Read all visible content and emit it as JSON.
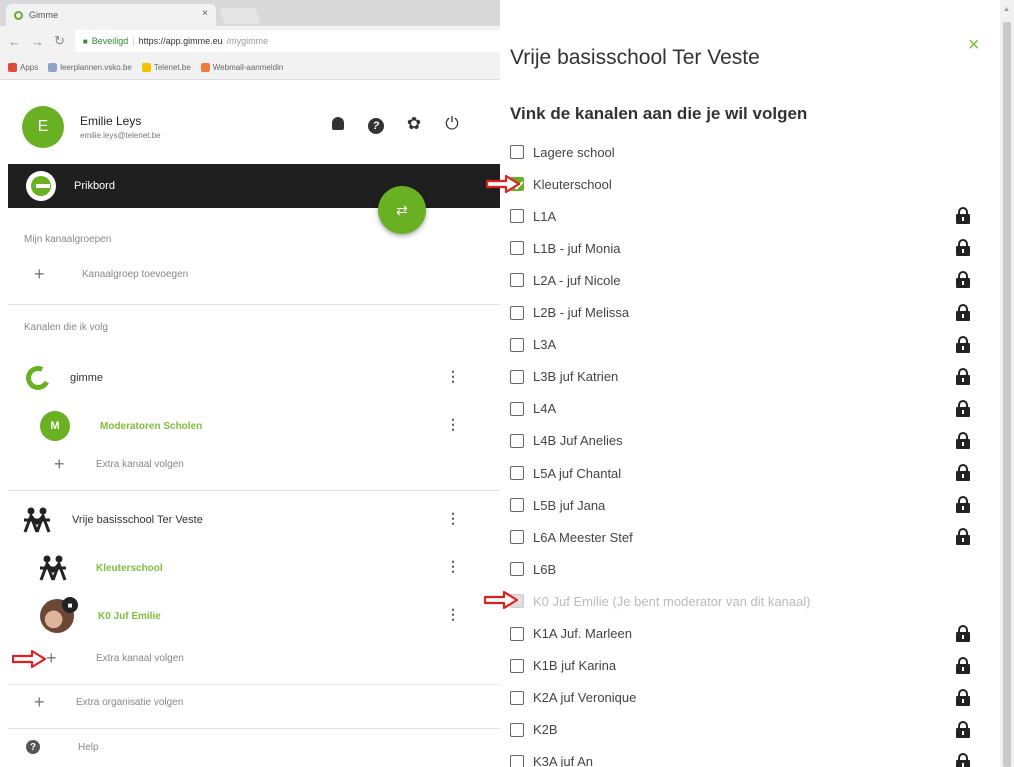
{
  "browser": {
    "tab_title": "Gimme",
    "tab_close": "×",
    "secure_label": "Beveiligd",
    "url_host": "https://app.gimme.eu",
    "url_path": "/mygimme",
    "bookmarks": [
      {
        "label": "Apps",
        "color": "#e14b3b"
      },
      {
        "label": "leerplannen.vsko.be",
        "color": "#8aa3c7"
      },
      {
        "label": "Telenet.be",
        "color": "#f5c100"
      },
      {
        "label": "Webmail-aanmeldin",
        "color": "#f07a3a"
      }
    ]
  },
  "sidebar": {
    "user": {
      "avatar_letter": "E",
      "name": "Emilie Leys",
      "email": "emilie.leys@telenet.be"
    },
    "header_icons": [
      "bell-icon",
      "help-icon",
      "gear-icon",
      "power-icon"
    ],
    "prikbord_label": "Prikbord",
    "fab_icon": "⇄",
    "channelgroups_title": "Mijn kanaalgroepen",
    "add_channelgroup": "Kanaalgroep toevoegen",
    "followed_title": "Kanalen die ik volg",
    "orgs": [
      {
        "name": "gimme",
        "channels": [
          {
            "avatar_letter": "M",
            "name": "Moderatoren Scholen"
          }
        ],
        "extra": "Extra kanaal volgen"
      },
      {
        "name": "Vrije basisschool Ter Veste",
        "channels": [
          {
            "name": "Kleuterschool"
          },
          {
            "name": "K0 Juf Emilie"
          }
        ],
        "extra": "Extra kanaal volgen"
      }
    ],
    "extra_org": "Extra organisatie volgen",
    "help": "Help",
    "plus": "+",
    "kebab": "⋮"
  },
  "dialog": {
    "title": "Vrije basisschool Ter Veste",
    "close": "×",
    "subtitle": "Vink de kanalen aan die je wil volgen",
    "channels": [
      {
        "label": "Lagere school",
        "checked": false,
        "locked": false
      },
      {
        "label": "Kleuterschool",
        "checked": true,
        "locked": false
      },
      {
        "label": "L1A",
        "checked": false,
        "locked": true
      },
      {
        "label": "L1B - juf Monia",
        "checked": false,
        "locked": true
      },
      {
        "label": "L2A - juf Nicole",
        "checked": false,
        "locked": true
      },
      {
        "label": "L2B - juf Melissa",
        "checked": false,
        "locked": true
      },
      {
        "label": "L3A",
        "checked": false,
        "locked": true
      },
      {
        "label": "L3B juf Katrien",
        "checked": false,
        "locked": true
      },
      {
        "label": "L4A",
        "checked": false,
        "locked": true
      },
      {
        "label": "L4B Juf Anelies",
        "checked": false,
        "locked": true
      },
      {
        "label": "L5A juf Chantal",
        "checked": false,
        "locked": true
      },
      {
        "label": "L5B juf Jana",
        "checked": false,
        "locked": true
      },
      {
        "label": "L6A Meester Stef",
        "checked": false,
        "locked": true
      },
      {
        "label": "L6B",
        "checked": false,
        "locked": false
      },
      {
        "label": "K0 Juf Emilie (Je bent moderator van dit kanaal)",
        "checked": false,
        "locked": false,
        "disabled": true
      },
      {
        "label": "K1A Juf. Marleen",
        "checked": false,
        "locked": true
      },
      {
        "label": "K1B juf Karina",
        "checked": false,
        "locked": true
      },
      {
        "label": "K2A juf Veronique",
        "checked": false,
        "locked": true
      },
      {
        "label": "K2B",
        "checked": false,
        "locked": true
      },
      {
        "label": "K3A juf An",
        "checked": false,
        "locked": true
      }
    ]
  },
  "colors": {
    "accent_green": "#6ab023",
    "annotation_red": "#e02020"
  }
}
